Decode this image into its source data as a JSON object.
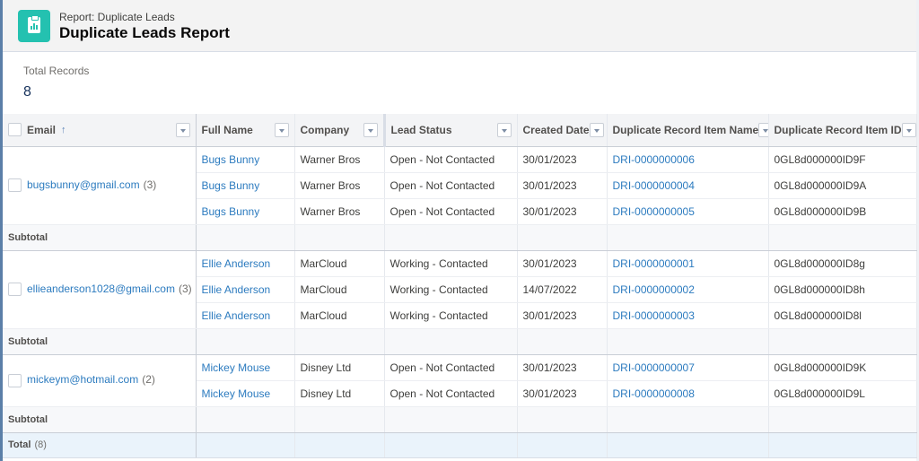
{
  "header": {
    "subtitle": "Report: Duplicate Leads",
    "title": "Duplicate Leads Report",
    "icon": "report-icon",
    "icon_color": "#24c1b0"
  },
  "summary": {
    "label": "Total Records",
    "value": "8"
  },
  "table": {
    "columns": [
      {
        "label": "Email",
        "sort": "ascending"
      },
      {
        "label": "Full Name"
      },
      {
        "label": "Company"
      },
      {
        "label": "Lead Status"
      },
      {
        "label": "Created Date"
      },
      {
        "label": "Duplicate Record Item Name"
      },
      {
        "label": "Duplicate Record Item ID"
      }
    ],
    "groups": [
      {
        "email": "bugsbunny@gmail.com",
        "count": "(3)",
        "rows": [
          {
            "full_name": "Bugs Bunny",
            "company": "Warner Bros",
            "lead_status": "Open - Not Contacted",
            "created_date": "30/01/2023",
            "dri_name": "DRI-0000000006",
            "dri_id": "0GL8d000000ID9F"
          },
          {
            "full_name": "Bugs Bunny",
            "company": "Warner Bros",
            "lead_status": "Open - Not Contacted",
            "created_date": "30/01/2023",
            "dri_name": "DRI-0000000004",
            "dri_id": "0GL8d000000ID9A"
          },
          {
            "full_name": "Bugs Bunny",
            "company": "Warner Bros",
            "lead_status": "Open - Not Contacted",
            "created_date": "30/01/2023",
            "dri_name": "DRI-0000000005",
            "dri_id": "0GL8d000000ID9B"
          }
        ],
        "subtotal_label": "Subtotal"
      },
      {
        "email": "ellieanderson1028@gmail.com",
        "count": "(3)",
        "rows": [
          {
            "full_name": "Ellie Anderson",
            "company": "MarCloud",
            "lead_status": "Working - Contacted",
            "created_date": "30/01/2023",
            "dri_name": "DRI-0000000001",
            "dri_id": "0GL8d000000ID8g"
          },
          {
            "full_name": "Ellie Anderson",
            "company": "MarCloud",
            "lead_status": "Working - Contacted",
            "created_date": "14/07/2022",
            "dri_name": "DRI-0000000002",
            "dri_id": "0GL8d000000ID8h"
          },
          {
            "full_name": "Ellie Anderson",
            "company": "MarCloud",
            "lead_status": "Working - Contacted",
            "created_date": "30/01/2023",
            "dri_name": "DRI-0000000003",
            "dri_id": "0GL8d000000ID8l"
          }
        ],
        "subtotal_label": "Subtotal"
      },
      {
        "email": "mickeym@hotmail.com",
        "count": "(2)",
        "rows": [
          {
            "full_name": "Mickey Mouse",
            "company": "Disney Ltd",
            "lead_status": "Open - Not Contacted",
            "created_date": "30/01/2023",
            "dri_name": "DRI-0000000007",
            "dri_id": "0GL8d000000ID9K"
          },
          {
            "full_name": "Mickey Mouse",
            "company": "Disney Ltd",
            "lead_status": "Open - Not Contacted",
            "created_date": "30/01/2023",
            "dri_name": "DRI-0000000008",
            "dri_id": "0GL8d000000ID9L"
          }
        ],
        "subtotal_label": "Subtotal"
      }
    ],
    "total": {
      "label": "Total",
      "count": "(8)"
    }
  },
  "colors": {
    "link": "#2c7bbf",
    "header_bg": "#f3f3f3",
    "total_row_bg": "#eaf3fb"
  }
}
